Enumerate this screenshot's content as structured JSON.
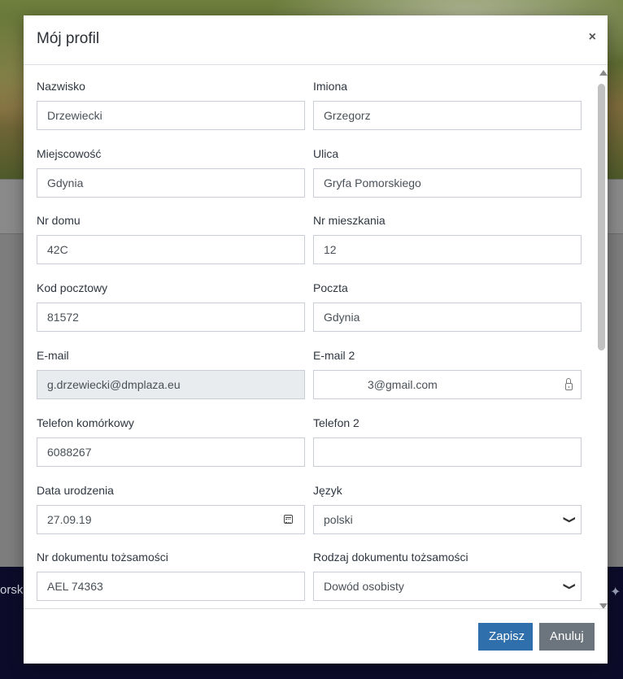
{
  "background": {
    "footer_text": "orska"
  },
  "modal": {
    "title": "Mój profil",
    "close_label": "×"
  },
  "form": {
    "nazwisko": {
      "label": "Nazwisko",
      "value": "Drzewiecki"
    },
    "imiona": {
      "label": "Imiona",
      "value": "Grzegorz"
    },
    "miejscowosc": {
      "label": "Miejscowość",
      "value": "Gdynia"
    },
    "ulica": {
      "label": "Ulica",
      "value": "Gryfa Pomorskiego"
    },
    "nr_domu": {
      "label": "Nr domu",
      "value": "42C"
    },
    "nr_mieszkania": {
      "label": "Nr mieszkania",
      "value": "12"
    },
    "kod_pocztowy": {
      "label": "Kod pocztowy",
      "value": "81572"
    },
    "poczta": {
      "label": "Poczta",
      "value": "Gdynia"
    },
    "email": {
      "label": "E-mail",
      "value": "g.drzewiecki@dmplaza.eu"
    },
    "email2": {
      "label": "E-mail 2",
      "value": "3@gmail.com"
    },
    "telefon_komorkowy": {
      "label": "Telefon komórkowy",
      "value": "6088267"
    },
    "telefon2": {
      "label": "Telefon 2",
      "value": ""
    },
    "data_urodzenia": {
      "label": "Data urodzenia",
      "value": "27.09.19"
    },
    "jezyk": {
      "label": "Język",
      "value": "polski"
    },
    "nr_dokumentu": {
      "label": "Nr dokumentu tożsamości",
      "value": "AEL 74363"
    },
    "rodzaj_dokumentu": {
      "label": "Rodzaj dokumentu tożsamości",
      "value": "Dowód osobisty"
    }
  },
  "footer": {
    "save_label": "Zapisz",
    "cancel_label": "Anuluj"
  },
  "icons": {
    "close": "close-icon",
    "calendar": "calendar-icon",
    "lock": "lock-icon",
    "chevron": "chevron-down-icon"
  },
  "colors": {
    "save_button": "#2f6fab",
    "cancel_button": "#6c757d",
    "footer_background": "#0c0c2a"
  }
}
